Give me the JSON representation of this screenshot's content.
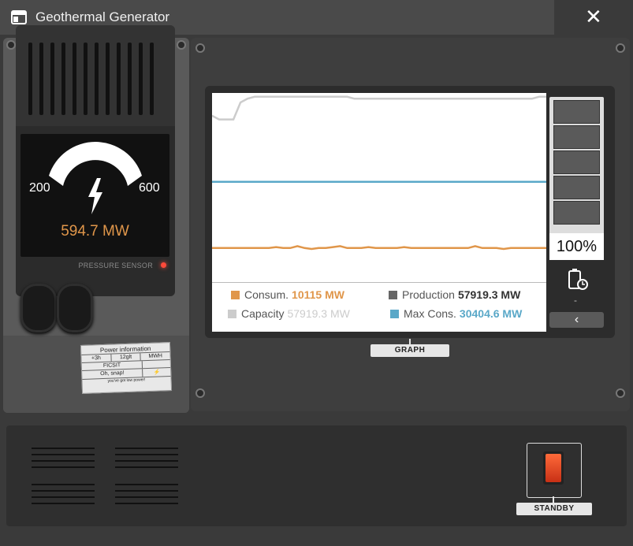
{
  "window": {
    "title": "Geothermal Generator",
    "close_label": "✕"
  },
  "gauge": {
    "min_label": "200",
    "max_label": "600",
    "value_text": "594.7 MW",
    "pressure_label": "PRESSURE SENSOR",
    "value_color": "#e0964a"
  },
  "power_card": {
    "title": "Power information",
    "cells_row1": [
      "+3h",
      "12glt",
      "MWH"
    ],
    "brand": "FICSIT",
    "line": "Oh, snap!",
    "footer": "you've got low power!"
  },
  "chart_data": {
    "type": "line",
    "series": [
      {
        "name": "Capacity",
        "color": "#cccccc",
        "values": [
          0.88,
          0.86,
          0.86,
          0.86,
          0.95,
          0.97,
          0.98,
          0.98,
          0.98,
          0.98,
          0.98,
          0.98,
          0.98,
          0.98,
          0.98,
          0.98,
          0.98,
          0.98,
          0.98,
          0.98,
          0.97,
          0.97,
          0.97,
          0.97,
          0.97,
          0.97,
          0.97,
          0.97,
          0.97,
          0.97,
          0.97,
          0.97,
          0.97,
          0.97,
          0.97,
          0.97,
          0.97,
          0.97,
          0.97,
          0.97,
          0.97,
          0.97,
          0.97,
          0.97,
          0.97,
          0.97,
          0.98,
          0.98
        ]
      },
      {
        "name": "Max Cons.",
        "color": "#5aa8c8",
        "values": [
          0.53,
          0.53,
          0.53,
          0.53,
          0.53,
          0.53,
          0.53,
          0.53,
          0.53,
          0.53,
          0.53,
          0.53,
          0.53,
          0.53,
          0.53,
          0.53,
          0.53,
          0.53,
          0.53,
          0.53,
          0.53,
          0.53,
          0.53,
          0.53,
          0.53,
          0.53,
          0.53,
          0.53,
          0.53,
          0.53,
          0.53,
          0.53,
          0.53,
          0.53,
          0.53,
          0.53,
          0.53,
          0.53,
          0.53,
          0.53,
          0.53,
          0.53,
          0.53,
          0.53,
          0.53,
          0.53,
          0.53,
          0.53
        ]
      },
      {
        "name": "Consum.",
        "color": "#e0964a",
        "values": [
          0.18,
          0.18,
          0.18,
          0.18,
          0.18,
          0.18,
          0.18,
          0.18,
          0.18,
          0.185,
          0.18,
          0.18,
          0.19,
          0.18,
          0.175,
          0.18,
          0.18,
          0.185,
          0.19,
          0.18,
          0.18,
          0.18,
          0.185,
          0.18,
          0.18,
          0.18,
          0.18,
          0.185,
          0.18,
          0.18,
          0.18,
          0.18,
          0.18,
          0.18,
          0.18,
          0.18,
          0.18,
          0.19,
          0.18,
          0.18,
          0.18,
          0.175,
          0.18,
          0.18,
          0.18,
          0.18,
          0.18,
          0.18
        ]
      }
    ],
    "ylim": [
      0,
      1
    ],
    "grid": false
  },
  "legend": {
    "consumption": {
      "label": "Consum.",
      "value": "10115 MW",
      "color": "#e0964a"
    },
    "production": {
      "label": "Production",
      "value": "57919.3 MW",
      "color": "#666666"
    },
    "capacity": {
      "label": "Capacity",
      "value": "57919.3 MW",
      "color": "#cccccc"
    },
    "max_consumption": {
      "label": "Max Cons.",
      "value": "30404.6 MW",
      "color": "#5aa8c8"
    }
  },
  "battery": {
    "percent_text": "100%",
    "level": 1.0,
    "status_text": "-",
    "back_label": "‹"
  },
  "tags": {
    "graph": "GRAPH",
    "standby": "STANDBY"
  },
  "icons": {
    "window": "window-icon",
    "bolt": "lightning-bolt-icon",
    "battery": "battery-timer-icon"
  }
}
